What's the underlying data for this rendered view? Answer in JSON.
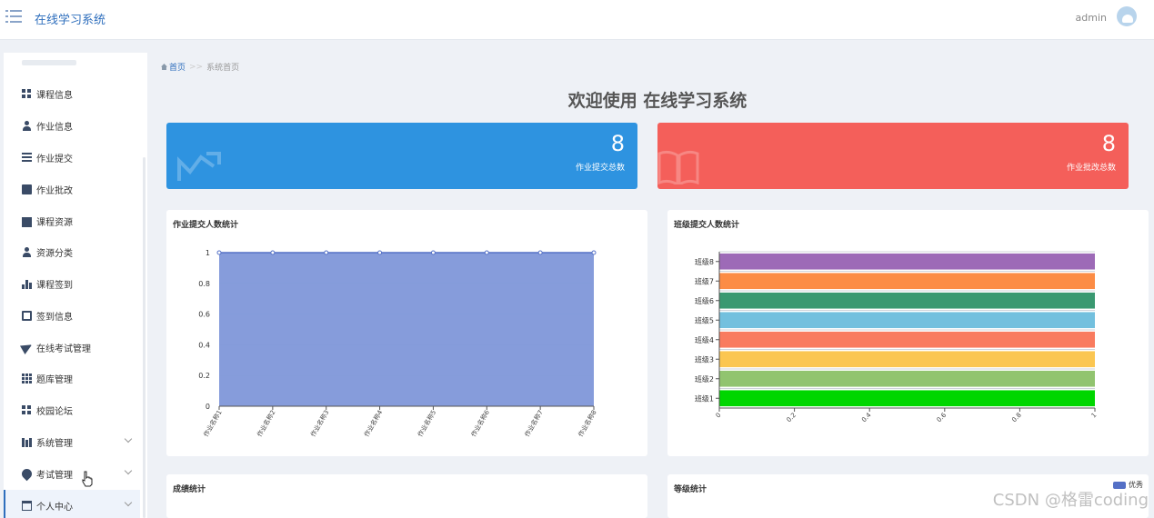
{
  "header": {
    "app_title": "在线学习系统",
    "user_name": "admin"
  },
  "sidebar": {
    "items": [
      {
        "label": "课程信息",
        "icon": "grid-icon"
      },
      {
        "label": "作业信息",
        "icon": "user-icon"
      },
      {
        "label": "作业提交",
        "icon": "list-icon"
      },
      {
        "label": "作业批改",
        "icon": "comment-icon"
      },
      {
        "label": "课程资源",
        "icon": "video-icon"
      },
      {
        "label": "资源分类",
        "icon": "user-icon"
      },
      {
        "label": "课程签到",
        "icon": "bar-chart-icon"
      },
      {
        "label": "签到信息",
        "icon": "clipboard-icon"
      },
      {
        "label": "在线考试管理",
        "icon": "send-icon"
      },
      {
        "label": "题库管理",
        "icon": "grid9-icon"
      },
      {
        "label": "校园论坛",
        "icon": "grid-icon"
      },
      {
        "label": "系统管理",
        "icon": "chart-icon",
        "expandable": true
      },
      {
        "label": "考试管理",
        "icon": "map-pin-icon",
        "expandable": true
      },
      {
        "label": "个人中心",
        "icon": "window-icon",
        "expandable": true,
        "active": true
      }
    ]
  },
  "breadcrumb": {
    "home": "首页",
    "separator": ">>",
    "current": "系统首页"
  },
  "welcome": "欢迎使用 在线学习系统",
  "cards": [
    {
      "value": "8",
      "label": "作业提交总数",
      "color": "#2e93e0",
      "icon": "trend-chart-icon"
    },
    {
      "value": "8",
      "label": "作业批改总数",
      "color": "#f45f5a",
      "icon": "book-icon"
    }
  ],
  "panels": {
    "submit": "作业提交人数统计",
    "class": "班级提交人数统计",
    "score": "成绩统计",
    "grade": "等级统计"
  },
  "legend_excellent": "优秀",
  "watermark": "CSDN @格雷coding",
  "chart_data": [
    {
      "type": "area",
      "title": "作业提交人数统计",
      "categories": [
        "作业名称1",
        "作业名称2",
        "作业名称3",
        "作业名称4",
        "作业名称5",
        "作业名称6",
        "作业名称7",
        "作业名称8"
      ],
      "values": [
        1,
        1,
        1,
        1,
        1,
        1,
        1,
        1
      ],
      "ylim": [
        0,
        1
      ],
      "yticks": [
        "0",
        "0.2",
        "0.4",
        "0.6",
        "0.8",
        "1"
      ],
      "color": "#7f97d9"
    },
    {
      "type": "bar",
      "orientation": "horizontal",
      "title": "班级提交人数统计",
      "categories": [
        "班级1",
        "班级2",
        "班级3",
        "班级4",
        "班级5",
        "班级6",
        "班级7",
        "班级8"
      ],
      "values": [
        1,
        1,
        1,
        1,
        1,
        1,
        1,
        1
      ],
      "colors": [
        "#00d600",
        "#91c46f",
        "#fbc651",
        "#f97b5f",
        "#73c0de",
        "#3a9971",
        "#fc8c45",
        "#9d6ab7"
      ],
      "xlim": [
        0,
        1
      ],
      "xticks": [
        "0",
        "0.2",
        "0.4",
        "0.6",
        "0.8",
        "1"
      ]
    }
  ]
}
